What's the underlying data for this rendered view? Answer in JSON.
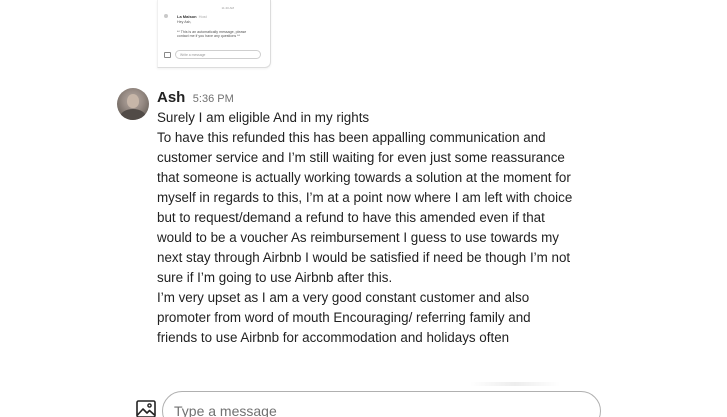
{
  "attachment": {
    "time": "11:40 AM",
    "name": "La Maison",
    "name_sub": "Host",
    "lines": [
      "Hey Ash,",
      "",
      "** This is an automatically message, please",
      "contact me if you have any questions **"
    ],
    "input_placeholder": "Write a message"
  },
  "message": {
    "sender": "Ash",
    "timestamp": "5:36 PM",
    "lines": [
      "Surely I am eligible And in my rights",
      "To have this refunded this has been appalling communication and",
      "customer service and I’m still waiting for even just some reassurance",
      "that someone is actually working towards a solution at the moment for",
      "myself in regards to this, I’m at a point now where I am left with choice",
      "but to request/demand a refund to have this amended even if that",
      "would to be a voucher As reimbursement I guess to use towards my",
      "next stay through Airbnb I would be satisfied if need be though I’m not",
      "sure if I’m going to use Airbnb after this.",
      "I’m very upset as I am a very good constant customer and also",
      "promoter from word of mouth Encouraging/ referring family and",
      "friends to use Airbnb for accommodation and holidays often"
    ]
  },
  "composer": {
    "placeholder": "Type a message",
    "attach_icon": "image-icon"
  }
}
